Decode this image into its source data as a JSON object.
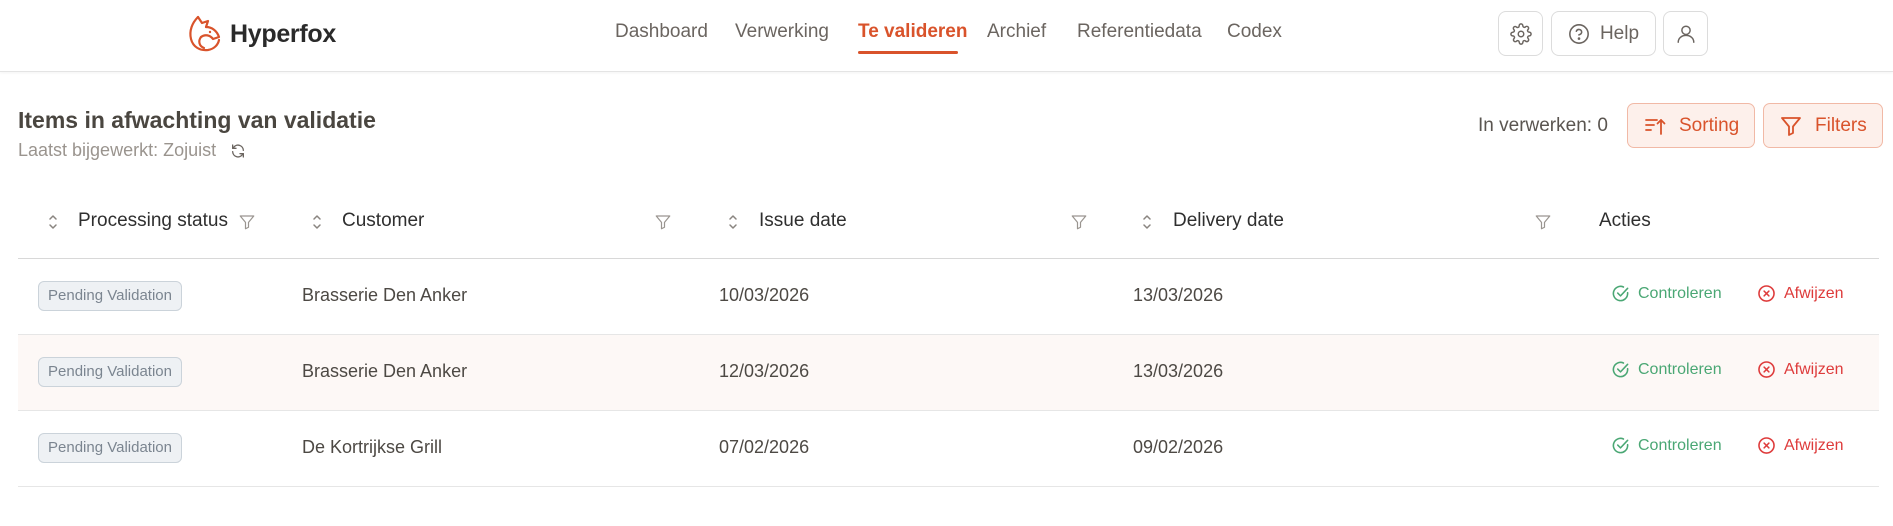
{
  "brand": {
    "name": "Hyperfox",
    "accent": "#d9532b"
  },
  "nav": {
    "items": [
      {
        "label": "Dashboard"
      },
      {
        "label": "Verwerking"
      },
      {
        "label": "Te valideren",
        "active": true
      },
      {
        "label": "Archief"
      },
      {
        "label": "Referentiedata"
      },
      {
        "label": "Codex"
      }
    ]
  },
  "toolbar": {
    "settings_icon": "gear-icon",
    "help_label": "Help",
    "help_icon": "question-circle-icon",
    "profile_icon": "user-icon"
  },
  "page": {
    "title": "Items in afwachting van validatie",
    "updated": "Laatst bijgewerkt: Zojuist",
    "processing": "In verwerken: 0",
    "sorting_label": "Sorting",
    "filters_label": "Filters"
  },
  "table": {
    "columns": [
      "Processing status",
      "Customer",
      "Issue date",
      "Delivery date",
      "Acties"
    ],
    "actions": {
      "approve": "Controleren",
      "reject": "Afwijzen"
    },
    "rows": [
      {
        "status": "Pending Validation",
        "customer": "Brasserie Den Anker",
        "issue_date": "10/03/2026",
        "delivery_date": "13/03/2026"
      },
      {
        "status": "Pending Validation",
        "customer": "Brasserie Den Anker",
        "issue_date": "12/03/2026",
        "delivery_date": "13/03/2026"
      },
      {
        "status": "Pending Validation",
        "customer": "De Kortrijkse Grill",
        "issue_date": "07/02/2026",
        "delivery_date": "09/02/2026"
      }
    ]
  },
  "colors": {
    "approve": "#4aa774",
    "reject": "#de3b3b",
    "badge_bg": "#eef1f4",
    "row_highlight": "#fdf8f6"
  }
}
